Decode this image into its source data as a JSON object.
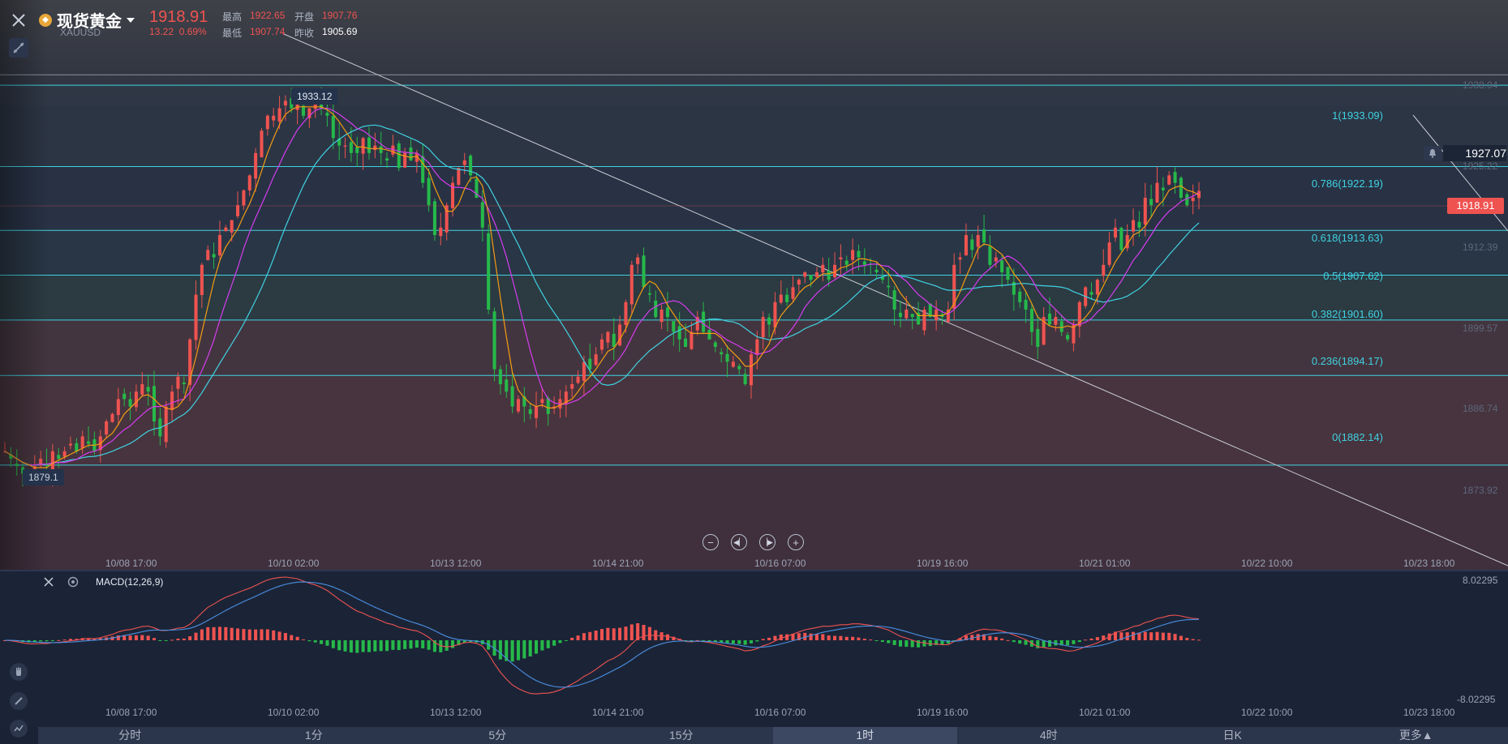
{
  "header": {
    "symbol_name": "现货黄金",
    "symbol_code": "XAUUSD",
    "last_price": "1918.91",
    "change": "13.22",
    "change_pct": "0.69%",
    "high_label": "最高",
    "high_value": "1922.65",
    "open_label": "开盘",
    "open_value": "1907.76",
    "low_label": "最低",
    "low_value": "1907.74",
    "prev_close_label": "昨收",
    "prev_close_value": "1905.69"
  },
  "markers": {
    "high_tag": "1933.12",
    "low_tag": "1879.1",
    "alert_price": "1927.07",
    "current_price": "1918.91"
  },
  "right_axis": [
    "1938.04",
    "1925.22",
    "1912.39",
    "1899.57",
    "1886.74",
    "1873.92"
  ],
  "fib_levels": [
    {
      "label": "1(1933.09)",
      "value": 1933.09
    },
    {
      "label": "0.786(1922.19)",
      "value": 1922.19
    },
    {
      "label": "0.618(1913.63)",
      "value": 1913.63
    },
    {
      "label": "0.5(1907.62)",
      "value": 1907.62
    },
    {
      "label": "0.382(1901.60)",
      "value": 1901.6
    },
    {
      "label": "0.236(1894.17)",
      "value": 1894.17
    },
    {
      "label": "0(1882.14)",
      "value": 1882.14
    }
  ],
  "x_ticks": [
    "10/08 17:00",
    "10/10 02:00",
    "10/13 12:00",
    "10/14 21:00",
    "10/16 07:00",
    "10/19 16:00",
    "10/21 01:00",
    "10/22 10:00",
    "10/23 18:00"
  ],
  "macd": {
    "title": "MACD(12,26,9)",
    "axis_top": "8.02295",
    "axis_bottom": "-8.02295"
  },
  "timeframe_tabs": [
    "分时",
    "1分",
    "5分",
    "15分",
    "1时",
    "4时",
    "日K",
    "更多▲"
  ],
  "active_tab_index": 4,
  "colors": {
    "up": "#ef5350",
    "down": "#26b94a",
    "fib": "#3fd2e2",
    "ma_fast": "#f39c12",
    "ma_mid": "#d63cf0",
    "ma_slow": "#3fd2e2",
    "background": "#1a2235"
  },
  "chart_data": {
    "type": "candlestick",
    "y_range": [
      1868,
      1943
    ],
    "closes": [
      1884,
      1883,
      1882,
      1881,
      1881,
      1882,
      1883,
      1882,
      1884,
      1883,
      1884,
      1885,
      1884,
      1886,
      1885,
      1884,
      1886,
      1888,
      1889,
      1891,
      1891,
      1890,
      1892,
      1893,
      1892,
      1888,
      1886,
      1890,
      1892,
      1894,
      1893,
      1899,
      1905,
      1909,
      1911,
      1910,
      1913,
      1914,
      1915,
      1917,
      1919,
      1921,
      1924,
      1927,
      1929,
      1929,
      1930,
      1931,
      1930,
      1931,
      1929,
      1930,
      1931,
      1930,
      1929,
      1926,
      1925,
      1925,
      1924,
      1924,
      1926,
      1924,
      1925,
      1924,
      1923,
      1925,
      1922,
      1924,
      1923,
      1924,
      1920,
      1917,
      1913,
      1914,
      1917,
      1920,
      1922,
      1923,
      1921,
      1918,
      1914,
      1903,
      1895,
      1893,
      1892,
      1890,
      1891,
      1890,
      1889,
      1890,
      1891,
      1889,
      1890,
      1891,
      1892,
      1893,
      1894,
      1896,
      1895,
      1897,
      1899,
      1900,
      1898,
      1901,
      1904,
      1909,
      1910,
      1906,
      1905,
      1902,
      1903,
      1902,
      1900,
      1899,
      1898,
      1900,
      1902,
      1900,
      1899,
      1898,
      1897,
      1896,
      1896,
      1895,
      1893,
      1897,
      1899,
      1902,
      1901,
      1904,
      1905,
      1904,
      1906,
      1907,
      1908,
      1907,
      1908,
      1909,
      1907,
      1909,
      1910,
      1909,
      1911,
      1910,
      1909,
      1909,
      1908,
      1907,
      1906,
      1903,
      1902,
      1903,
      1902,
      1901,
      1903,
      1902,
      1903,
      1902,
      1903,
      1909,
      1910,
      1913,
      1911,
      1913,
      1912,
      1909,
      1910,
      1908,
      1907,
      1905,
      1904,
      1903,
      1900,
      1898,
      1902,
      1901,
      1902,
      1900,
      1899,
      1901,
      1904,
      1906,
      1905,
      1907,
      1909,
      1912,
      1914,
      1911,
      1913,
      1915,
      1914,
      1918,
      1917,
      1920,
      1919,
      1921,
      1920,
      1918,
      1917,
      1918,
      1918.91
    ]
  }
}
